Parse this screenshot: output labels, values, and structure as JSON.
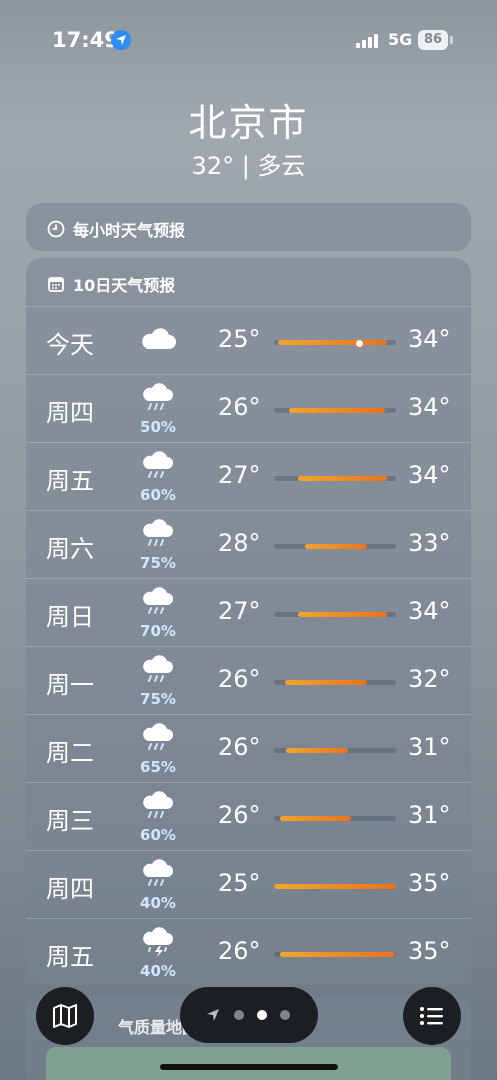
{
  "status": {
    "time": "17:49",
    "network": "5G",
    "battery": "86"
  },
  "location": {
    "city": "北京市",
    "current": "32° | 多云"
  },
  "hourly": {
    "title": "每小时天气预报"
  },
  "tenday": {
    "title": "10日天气预报",
    "days": [
      {
        "name": "今天",
        "icon": "cloud-icon",
        "pct": "",
        "lo": "25°",
        "hi": "34°",
        "range_start": 0.03,
        "range_end": 0.93,
        "current": 0.7
      },
      {
        "name": "周四",
        "icon": "rain-cloud-icon",
        "pct": "50%",
        "lo": "26°",
        "hi": "34°",
        "range_start": 0.12,
        "range_end": 0.91
      },
      {
        "name": "周五",
        "icon": "rain-cloud-icon",
        "pct": "60%",
        "lo": "27°",
        "hi": "34°",
        "range_start": 0.2,
        "range_end": 0.93
      },
      {
        "name": "周六",
        "icon": "rain-cloud-icon",
        "pct": "75%",
        "lo": "28°",
        "hi": "33°",
        "range_start": 0.25,
        "range_end": 0.76
      },
      {
        "name": "周日",
        "icon": "rain-cloud-icon",
        "pct": "70%",
        "lo": "27°",
        "hi": "34°",
        "range_start": 0.2,
        "range_end": 0.93
      },
      {
        "name": "周一",
        "icon": "rain-cloud-icon",
        "pct": "75%",
        "lo": "26°",
        "hi": "32°",
        "range_start": 0.09,
        "range_end": 0.76
      },
      {
        "name": "周二",
        "icon": "rain-cloud-icon",
        "pct": "65%",
        "lo": "26°",
        "hi": "31°",
        "range_start": 0.1,
        "range_end": 0.61
      },
      {
        "name": "周三",
        "icon": "rain-cloud-icon",
        "pct": "60%",
        "lo": "26°",
        "hi": "31°",
        "range_start": 0.05,
        "range_end": 0.63
      },
      {
        "name": "周四",
        "icon": "rain-cloud-icon",
        "pct": "40%",
        "lo": "25°",
        "hi": "35°",
        "range_start": 0.0,
        "range_end": 1.0
      },
      {
        "name": "周五",
        "icon": "thunderstorm-icon",
        "pct": "40%",
        "lo": "26°",
        "hi": "35°",
        "range_start": 0.05,
        "range_end": 0.99
      }
    ]
  },
  "aqi": {
    "title": "气质量地图"
  },
  "nav": {
    "map_icon": "map-icon",
    "list_icon": "list-icon"
  }
}
